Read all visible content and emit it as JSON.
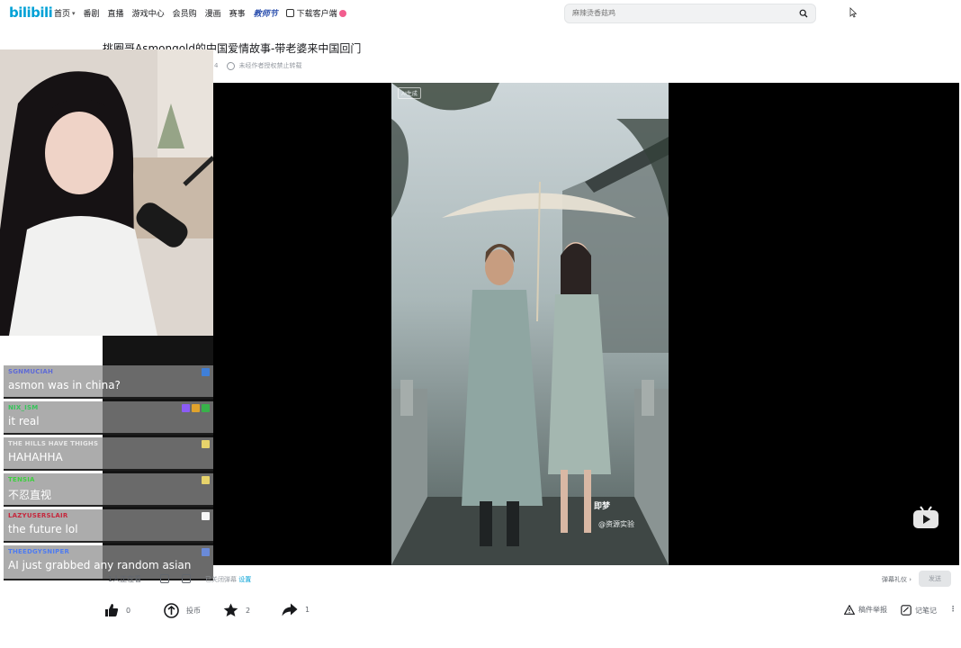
{
  "header": {
    "logo": "bilibili",
    "nav": [
      {
        "label": "首页",
        "dropdown": true
      },
      {
        "label": "番剧"
      },
      {
        "label": "直播"
      },
      {
        "label": "游戏中心"
      },
      {
        "label": "会员购"
      },
      {
        "label": "漫画"
      },
      {
        "label": "赛事"
      },
      {
        "label": "教师节",
        "accent": true
      },
      {
        "label": "下载客户端",
        "download": true,
        "dot": true
      }
    ],
    "search_placeholder": "麻辣烫香菇鸡"
  },
  "video": {
    "title": "挑圈哥Asmongold的中国爱情故事-带老婆来中国回门",
    "meta_prefix": "4",
    "meta_note": "未经作者授权禁止转载",
    "frame_tag": "AI生成",
    "watermark_logo": "即梦",
    "watermark_text": "@资源实验"
  },
  "chat": [
    {
      "name": "SGNMUCIAH",
      "name_color": "#5f6bd6",
      "text": "asmon was in china?",
      "badges": [
        "#3f7fd8"
      ]
    },
    {
      "name": "NIX_ISM",
      "name_color": "#36c45a",
      "text": "it real",
      "badges": [
        "#8b5cf6",
        "#e0a32c",
        "#38b24a"
      ]
    },
    {
      "name": "THE HILLS HAVE THIGHS",
      "name_color": "#e6e6e6",
      "text": "HAHAHHA",
      "badges": [
        "#e7d36b"
      ]
    },
    {
      "name": "TENSIA",
      "name_color": "#3fcf3f",
      "text": "不忍直视",
      "badges": [
        "#e7d36b"
      ]
    },
    {
      "name": "LAZYUSERSLAIR",
      "name_color": "#c5283d",
      "text": "the future lol",
      "badges": [
        "#f5f5f5"
      ]
    },
    {
      "name": "THEEDGYSNIPER",
      "name_color": "#4f7cf0",
      "text": "AI just grabbed any random asian",
      "badges": [
        "#6a8ad8"
      ]
    }
  ],
  "danmaku": {
    "viewers": "1人正在看",
    "label_prefix": "已关闭弹幕",
    "label_link": "设置",
    "send_label": "发送",
    "gift_label": "弹幕礼仪 ›"
  },
  "actions": {
    "like": "0",
    "coin": "投币",
    "fav": "2",
    "share": "1",
    "report": "稿件举报",
    "notes": "记笔记"
  }
}
